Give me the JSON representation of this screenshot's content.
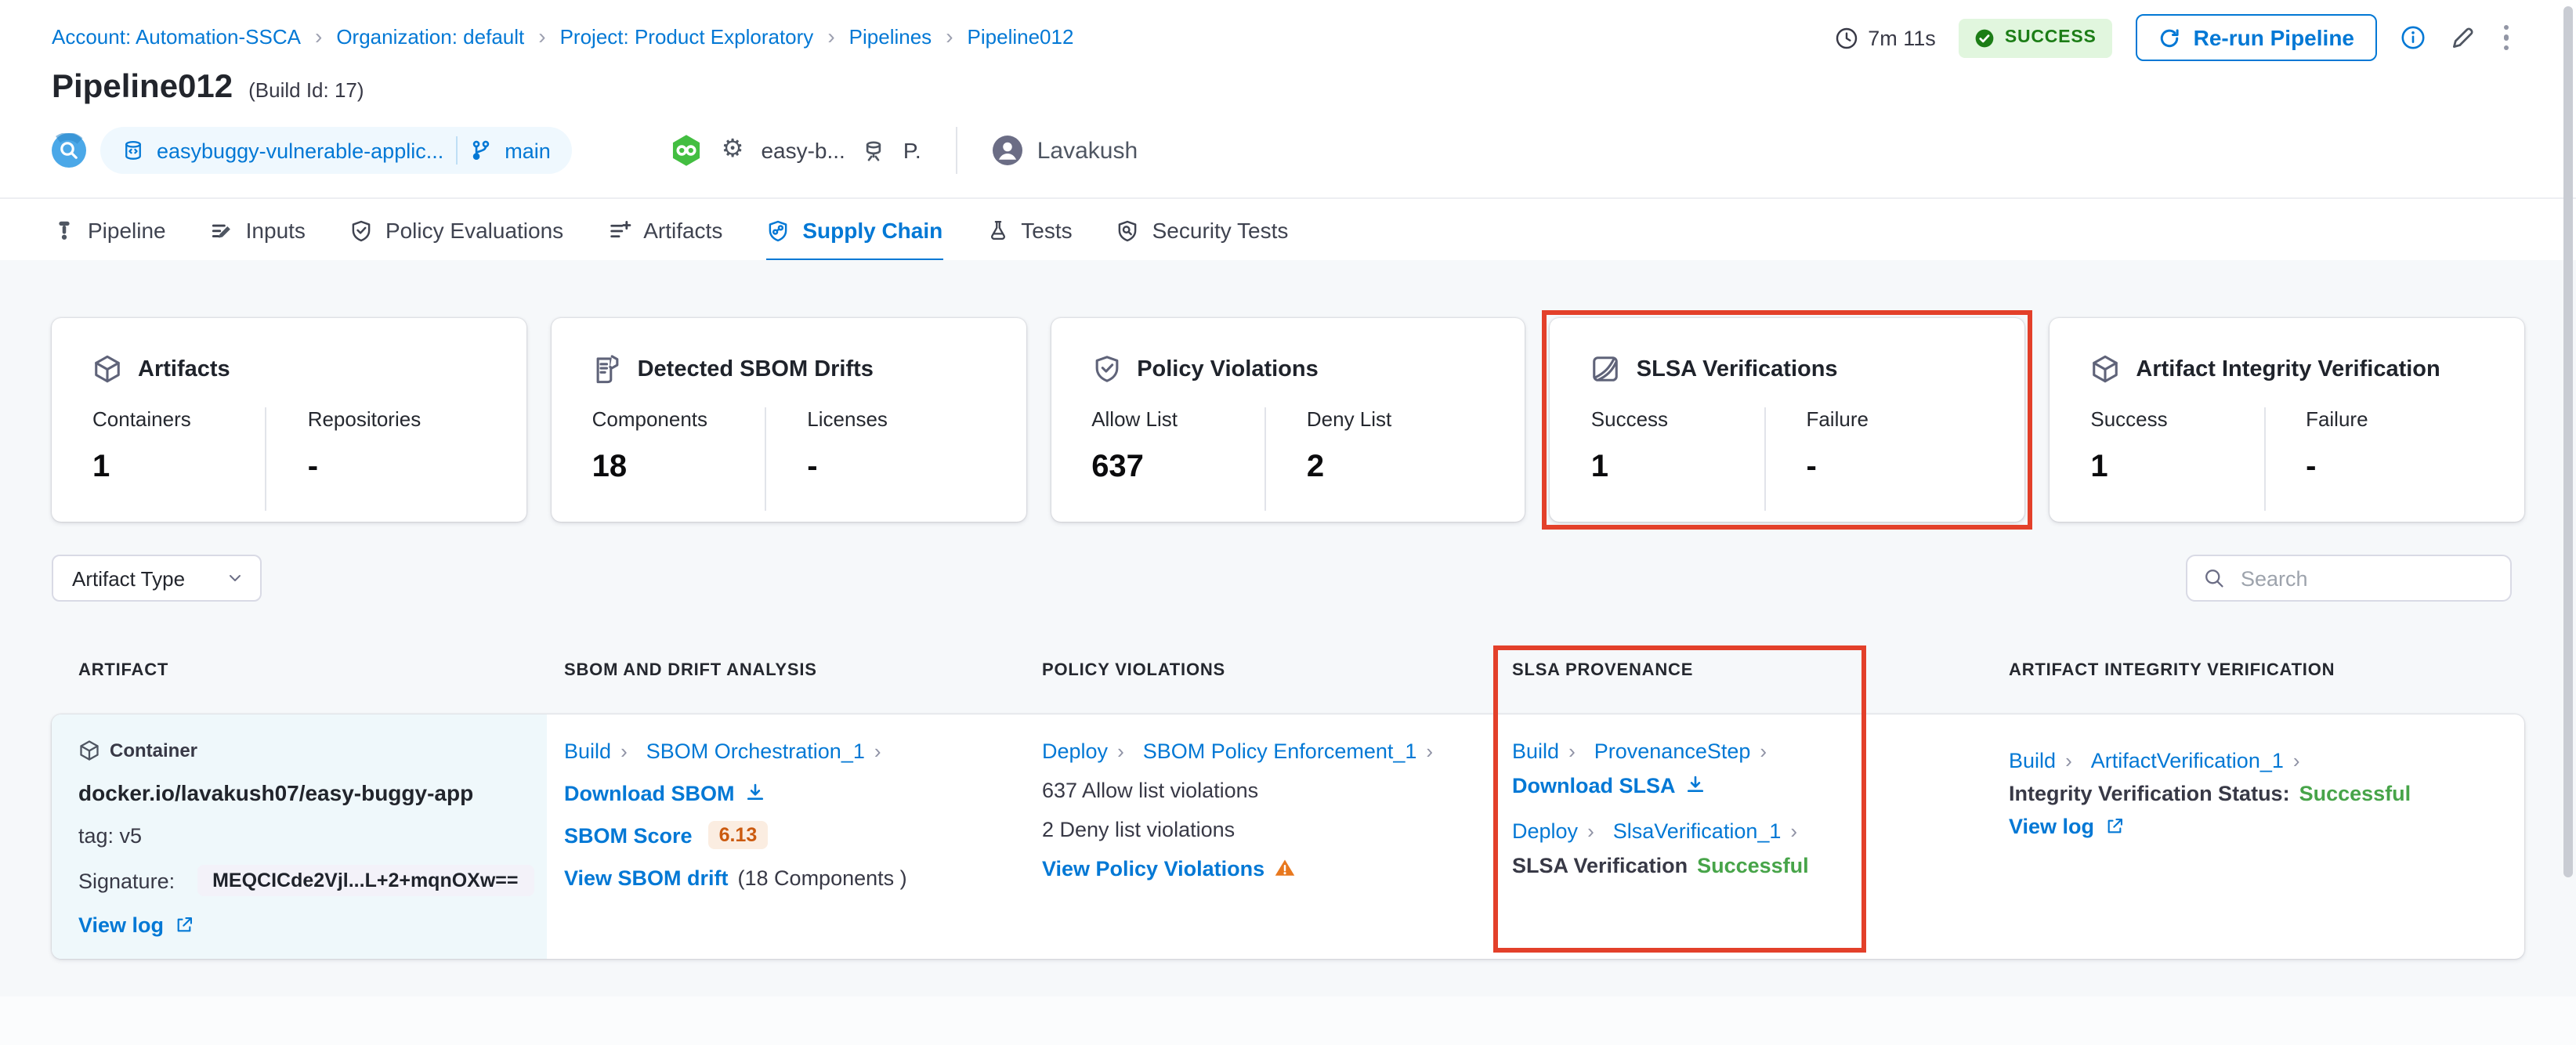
{
  "breadcrumb": {
    "items": [
      "Account: Automation-SSCA",
      "Organization: default",
      "Project: Product Exploratory",
      "Pipelines",
      "Pipeline012"
    ]
  },
  "header": {
    "title": "Pipeline012",
    "build_id": "(Build Id: 17)",
    "duration": "7m 11s",
    "status": "SUCCESS",
    "rerun_label": "Re-run Pipeline",
    "repo": {
      "name": "easybuggy-vulnerable-applic...",
      "branch": "main"
    },
    "trigger": {
      "service": "easy-b...",
      "initial": "P.",
      "user": "Lavakush"
    }
  },
  "tabs": [
    {
      "label": "Pipeline",
      "icon": "pipeline-icon"
    },
    {
      "label": "Inputs",
      "icon": "inputs-icon"
    },
    {
      "label": "Policy Evaluations",
      "icon": "policy-evaluations-icon"
    },
    {
      "label": "Artifacts",
      "icon": "artifacts-icon"
    },
    {
      "label": "Supply Chain",
      "icon": "supply-chain-icon",
      "active": true
    },
    {
      "label": "Tests",
      "icon": "tests-icon"
    },
    {
      "label": "Security Tests",
      "icon": "security-tests-icon"
    }
  ],
  "summary_cards": [
    {
      "title": "Artifacts",
      "icon": "cube-icon",
      "stats": [
        {
          "label": "Containers",
          "value": "1"
        },
        {
          "label": "Repositories",
          "value": "-"
        }
      ]
    },
    {
      "title": "Detected SBOM Drifts",
      "icon": "sbom-document-icon",
      "stats": [
        {
          "label": "Components",
          "value": "18"
        },
        {
          "label": "Licenses",
          "value": "-"
        }
      ]
    },
    {
      "title": "Policy Violations",
      "icon": "shield-check-icon",
      "stats": [
        {
          "label": "Allow List",
          "value": "637"
        },
        {
          "label": "Deny List",
          "value": "2"
        }
      ]
    },
    {
      "title": "SLSA Verifications",
      "icon": "slsa-icon",
      "highlighted": true,
      "stats": [
        {
          "label": "Success",
          "value": "1"
        },
        {
          "label": "Failure",
          "value": "-"
        }
      ]
    },
    {
      "title": "Artifact Integrity Verification",
      "icon": "cube-icon",
      "stats": [
        {
          "label": "Success",
          "value": "1"
        },
        {
          "label": "Failure",
          "value": "-"
        }
      ]
    }
  ],
  "filters": {
    "artifact_type_label": "Artifact Type",
    "search_placeholder": "Search"
  },
  "table": {
    "columns": [
      "ARTIFACT",
      "SBOM AND DRIFT ANALYSIS",
      "POLICY VIOLATIONS",
      "SLSA PROVENANCE",
      "ARTIFACT INTEGRITY VERIFICATION"
    ],
    "row": {
      "artifact": {
        "type": "Container",
        "image": "docker.io/lavakush07/easy-buggy-app",
        "tag": "tag: v5",
        "signature_label": "Signature:",
        "signature": "MEQCICde2Vjl...L+2+mqnOXw==",
        "view_log": "View log"
      },
      "sbom": {
        "stage": "Build",
        "step": "SBOM Orchestration_1",
        "download": "Download SBOM",
        "score_label": "SBOM Score",
        "score": "6.13",
        "drift_link": "View SBOM drift",
        "drift_note": "(18 Components )"
      },
      "policy": {
        "stage": "Deploy",
        "step": "SBOM Policy Enforcement_1",
        "allow": "637 Allow list violations",
        "deny": "2 Deny list violations",
        "view": "View Policy Violations"
      },
      "slsa": {
        "stage1": "Build",
        "step1": "ProvenanceStep",
        "download": "Download SLSA",
        "stage2": "Deploy",
        "step2": "SlsaVerification_1",
        "status_label": "SLSA Verification",
        "status_value": "Successful"
      },
      "integrity": {
        "stage": "Build",
        "step": "ArtifactVerification_1",
        "status_label": "Integrity Verification Status:",
        "status_value": "Successful",
        "view_log": "View log"
      }
    }
  },
  "colors": {
    "accent": "#0278D5",
    "highlight_red": "#E3402A",
    "success_green": "#47A449",
    "status_badge_bg": "#E1F6DE",
    "status_badge_text": "#1C7D16",
    "score_orange": "#CB5A0F"
  }
}
